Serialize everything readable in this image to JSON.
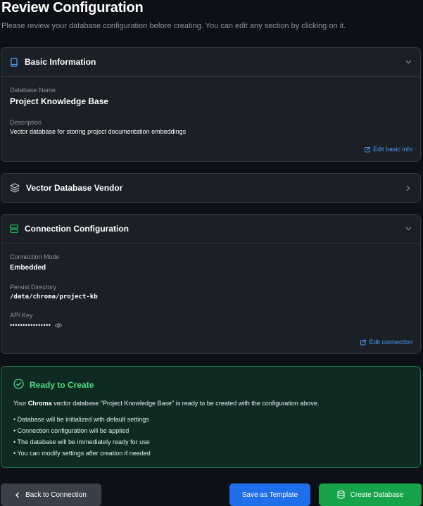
{
  "header": {
    "title": "Review Configuration",
    "subtitle": "Please review your database configuration before creating. You can edit any section by clicking on it."
  },
  "basic_info": {
    "title": "Basic Information",
    "icon": "book-icon",
    "name_label": "Database Name",
    "name_value": "Project Knowledge Base",
    "description_label": "Description",
    "description_value": "Vector database for storing project documentation embeddings",
    "edit_label": "Edit basic info"
  },
  "vendor": {
    "title": "Vector Database Vendor",
    "icon": "layers-icon"
  },
  "connection": {
    "title": "Connection Configuration",
    "icon": "server-icon",
    "mode_label": "Connection Mode",
    "mode_value": "Embedded",
    "persist_label": "Persist Directory",
    "persist_value": "/data/chroma/project-kb",
    "api_key_label": "API Key",
    "api_key_value": "••••••••••••••••",
    "edit_label": "Edit connection"
  },
  "ready": {
    "title": "Ready to Create",
    "text_prefix": "Your ",
    "text_vendor": "Chroma",
    "text_suffix": " vector database \"Project Knowledge Base\" is ready to be created with the configuration above.",
    "items": [
      "• Database will be initialized with default settings",
      "• Connection configuration will be applied",
      "• The database will be immediately ready for use",
      "• You can modify settings after creation if needed"
    ]
  },
  "footer": {
    "back_label": "Back to Connection",
    "template_label": "Save as Template",
    "create_label": "Create Database"
  },
  "colors": {
    "accent_blue": "#1f6feb",
    "accent_green": "#16a34a",
    "ready_green": "#4ade80",
    "link_blue": "#4b9cf5"
  }
}
